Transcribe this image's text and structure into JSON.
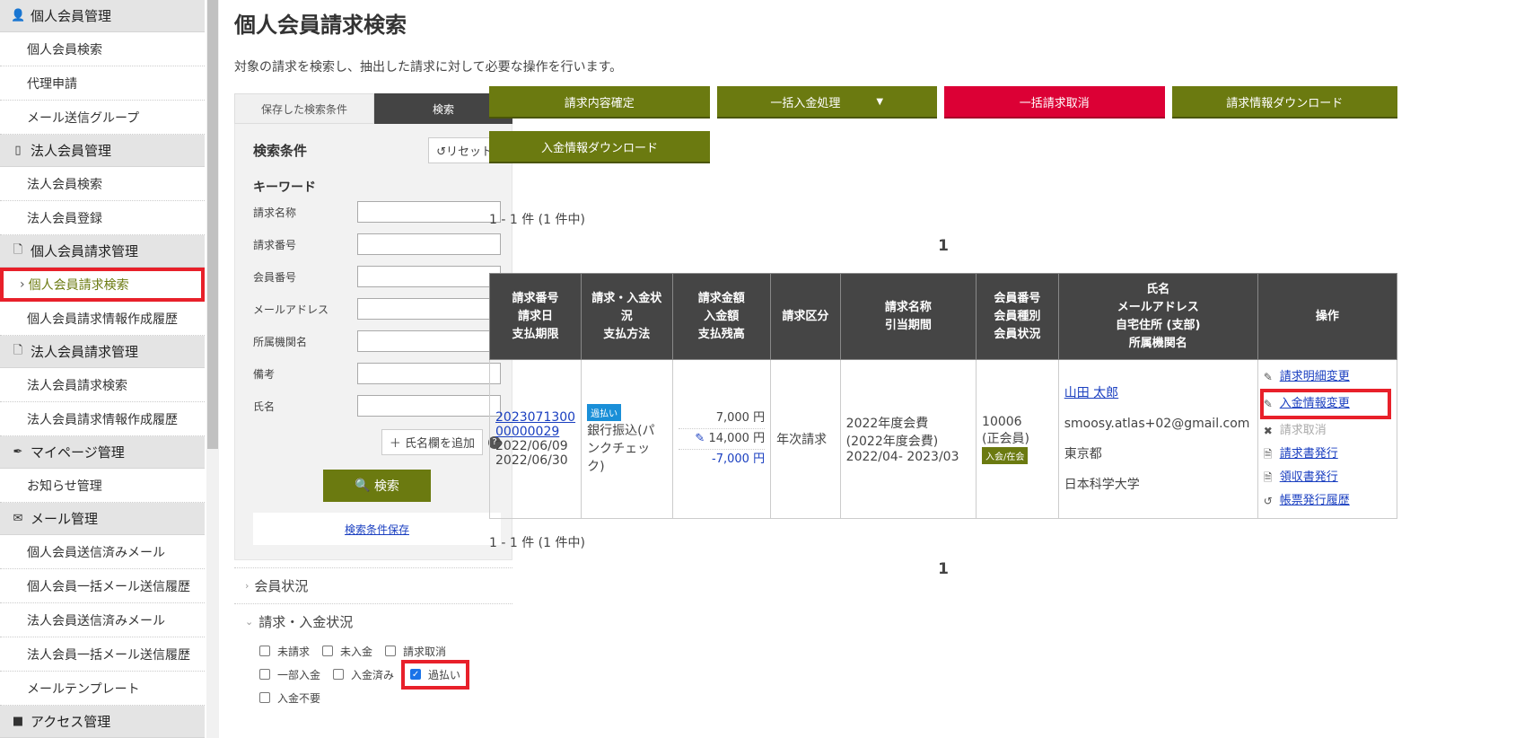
{
  "sidebar": {
    "sections": [
      {
        "label": "個人会員管理",
        "icon": "person-icon",
        "items": [
          "個人会員検索",
          "代理申請",
          "メール送信グループ"
        ]
      },
      {
        "label": "法人会員管理",
        "icon": "building-icon",
        "items": [
          "法人会員検索",
          "法人会員登録"
        ]
      },
      {
        "label": "個人会員請求管理",
        "icon": "document-icon",
        "items": [
          "個人会員請求検索",
          "個人会員請求情報作成履歴"
        ]
      },
      {
        "label": "法人会員請求管理",
        "icon": "document-icon",
        "items": [
          "法人会員請求検索",
          "法人会員請求情報作成履歴"
        ]
      },
      {
        "label": "マイページ管理",
        "icon": "pen-icon",
        "items": [
          "お知らせ管理"
        ]
      },
      {
        "label": "メール管理",
        "icon": "mail-icon",
        "items": [
          "個人会員送信済みメール",
          "個人会員一括メール送信履歴",
          "法人会員送信済みメール",
          "法人会員一括メール送信履歴",
          "メールテンプレート"
        ]
      },
      {
        "label": "アクセス管理"
      }
    ]
  },
  "page": {
    "title": "個人会員請求検索",
    "description": "対象の請求を検索し、抽出した請求に対して必要な操作を行います。"
  },
  "search_panel": {
    "tab_saved": "保存した検索条件",
    "tab_search": "検索",
    "heading": "検索条件",
    "reset": "リセット",
    "keyword": "キーワード",
    "fields": [
      "請求名称",
      "請求番号",
      "会員番号",
      "メールアドレス",
      "所属機関名",
      "備考",
      "氏名"
    ],
    "add_name": "氏名欄を追加",
    "search_btn": "検索",
    "save_link": "検索条件保存",
    "acc_member": "会員状況",
    "acc_status": "請求・入金状況",
    "checks": [
      [
        {
          "label": "未請求",
          "checked": false
        },
        {
          "label": "未入金",
          "checked": false
        },
        {
          "label": "請求取消",
          "checked": false
        }
      ],
      [
        {
          "label": "一部入金",
          "checked": false
        },
        {
          "label": "入金済み",
          "checked": false
        },
        {
          "label": "過払い",
          "checked": true
        }
      ],
      [
        {
          "label": "入金不要",
          "checked": false
        }
      ]
    ]
  },
  "actions": {
    "confirm": "請求内容確定",
    "bulk_payment": "一括入金処理",
    "bulk_cancel": "一括請求取消",
    "download_invoice": "請求情報ダウンロード",
    "download_payment": "入金情報ダウンロード"
  },
  "results": {
    "count": "1 - 1 件 (1 件中)",
    "page": "1",
    "headers": [
      "請求番号\n請求日\n支払期限",
      "請求・入金状\n況\n支払方法",
      "請求金額\n入金額\n支払残高",
      "請求区分",
      "請求名称\n引当期間",
      "会員番号\n会員種別\n会員状況",
      "氏名\nメールアドレス\n自宅住所 (支部)\n所属機関名",
      "操作"
    ],
    "row": {
      "invoice_no_1": "2023071300",
      "invoice_no_2": "00000029",
      "invoice_date": "2022/06/09",
      "due_date": "2022/06/30",
      "status_badge": "過払い",
      "pay_method": "銀行振込(パンクチェック)",
      "amount_billed": "7,000 円",
      "amount_paid": "14,000 円",
      "balance": "-7,000 円",
      "category": "年次請求",
      "name_1": "2022年度会費",
      "name_2": "(2022年度会費)",
      "period": "2022/04- 2023/03",
      "member_no": "10006",
      "member_type": "(正会員)",
      "member_status": "入会/在会",
      "person": "山田 太郎",
      "email": "smoosy.atlas+02@gmail.com",
      "address": "東京都",
      "org": "日本科学大学",
      "ops": {
        "edit_detail": "請求明細変更",
        "edit_payment": "入金情報変更",
        "cancel": "請求取消",
        "issue_invoice": "請求書発行",
        "issue_receipt": "領収書発行",
        "history": "帳票発行履歴"
      }
    }
  },
  "colors": {
    "olive": "#6b7a10",
    "red": "#dc0035",
    "highlight": "#e8202a",
    "link": "#1a3fc0"
  }
}
